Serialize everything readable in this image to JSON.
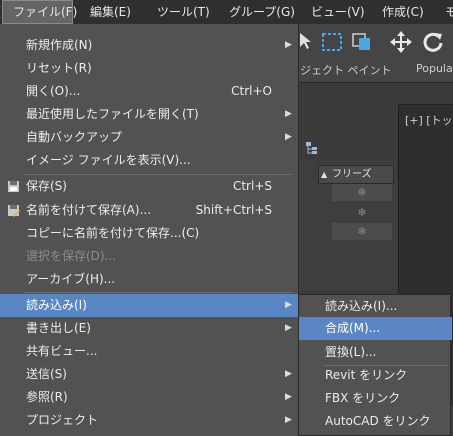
{
  "menubar": {
    "items": [
      {
        "label": "ファイル(F)"
      },
      {
        "label": "編集(E)"
      },
      {
        "label": "ツール(T)"
      },
      {
        "label": "グループ(G)"
      },
      {
        "label": "ビュー(V)"
      },
      {
        "label": "作成(C)"
      },
      {
        "label": "モ"
      }
    ],
    "active_index": 0
  },
  "toolbar": {
    "labels": [
      "ジェクト ペイント",
      "Popula"
    ]
  },
  "scene_explorer": {
    "column_header": "フリーズ",
    "sort_arrow": "▲",
    "freeze_glyph": "❄"
  },
  "viewport": {
    "label": "[+] [トッ"
  },
  "file_menu": {
    "items": [
      {
        "label": "新規作成(N)",
        "shortcut": "",
        "submenu": true
      },
      {
        "label": "リセット(R)",
        "shortcut": "",
        "submenu": false
      },
      {
        "label": "開く(O)...",
        "shortcut": "Ctrl+O",
        "submenu": false
      },
      {
        "label": "最近使用したファイルを開く(T)",
        "shortcut": "",
        "submenu": true
      },
      {
        "label": "自動バックアップ",
        "shortcut": "",
        "submenu": true
      },
      {
        "label": "イメージ ファイルを表示(V)...",
        "shortcut": "",
        "submenu": false
      },
      {
        "label": "保存(S)",
        "shortcut": "Ctrl+S",
        "submenu": false
      },
      {
        "label": "名前を付けて保存(A)...",
        "shortcut": "Shift+Ctrl+S",
        "submenu": false
      },
      {
        "label": "コピーに名前を付けて保存...(C)",
        "shortcut": "",
        "submenu": false
      },
      {
        "label": "選択を保存(D)...",
        "shortcut": "",
        "submenu": false,
        "disabled": true
      },
      {
        "label": "アーカイブ(H)...",
        "shortcut": "",
        "submenu": false
      },
      {
        "label": "読み込み(I)",
        "shortcut": "",
        "submenu": true,
        "highlighted": true
      },
      {
        "label": "書き出し(E)",
        "shortcut": "",
        "submenu": true
      },
      {
        "label": "共有ビュー...",
        "shortcut": "",
        "submenu": false
      },
      {
        "label": "送信(S)",
        "shortcut": "",
        "submenu": true
      },
      {
        "label": "参照(R)",
        "shortcut": "",
        "submenu": true
      },
      {
        "label": "プロジェクト",
        "shortcut": "",
        "submenu": true
      }
    ]
  },
  "import_submenu": {
    "items": [
      {
        "label": "読み込み(I)..."
      },
      {
        "label": "合成(M)...",
        "highlighted": true
      },
      {
        "label": "置換(L)..."
      },
      {
        "label": "Revit をリンク"
      },
      {
        "label": "FBX をリンク"
      },
      {
        "label": "AutoCAD をリンク"
      }
    ]
  },
  "colors": {
    "highlight": "#5a87c4",
    "menu_bg": "#525252",
    "menubar_bg": "#2f2f2f"
  }
}
